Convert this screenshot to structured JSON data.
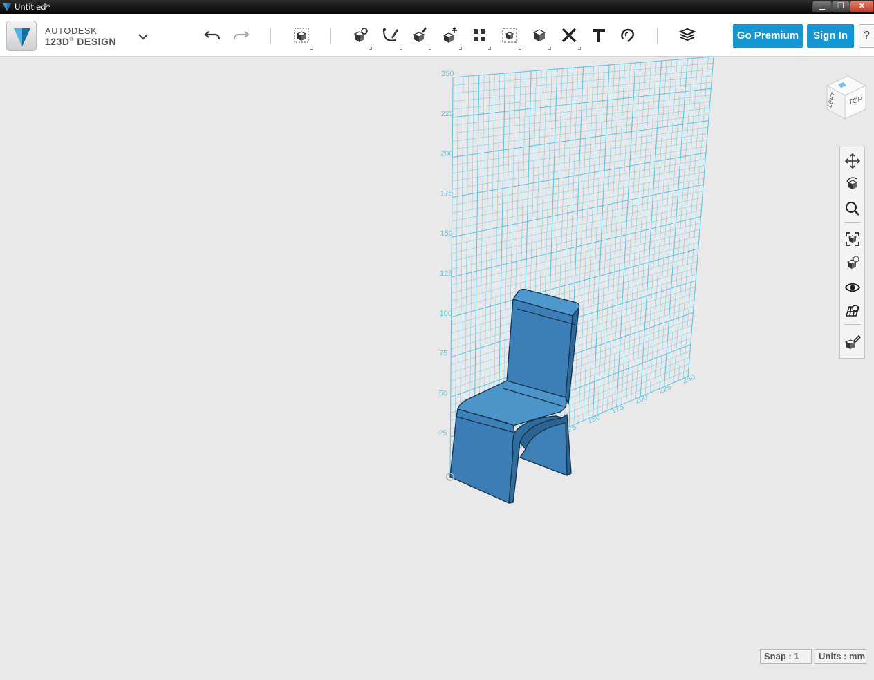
{
  "window": {
    "title": "Untitled*",
    "controls": {
      "minimize": "▁",
      "maximize": "❐",
      "close": "✕"
    }
  },
  "brand": {
    "line1": "AUTODESK",
    "line2": "123D",
    "line2_suffix": "DESIGN"
  },
  "toolbar": {
    "items": [
      {
        "icon": "undo-icon"
      },
      {
        "icon": "redo-icon"
      },
      {
        "icon": "transform-icon"
      },
      {
        "icon": "primitives-icon"
      },
      {
        "icon": "sketch-icon"
      },
      {
        "icon": "construct-icon"
      },
      {
        "icon": "modify-icon"
      },
      {
        "icon": "pattern-icon"
      },
      {
        "icon": "grouping-icon"
      },
      {
        "icon": "combine-icon"
      },
      {
        "icon": "measure-icon"
      },
      {
        "icon": "text-icon"
      },
      {
        "icon": "snap-icon"
      },
      {
        "icon": "material-icon"
      }
    ],
    "go_premium": "Go Premium",
    "sign_in": "Sign In",
    "help": "?"
  },
  "viewcube": {
    "left": "LEFT",
    "top": "TOP"
  },
  "grid": {
    "vertical_labels": [
      "250",
      "225",
      "200",
      "175",
      "150",
      "125",
      "100",
      "75",
      "50",
      "25"
    ],
    "horizontal_labels": [
      "125",
      "150",
      "175",
      "200",
      "225",
      "250"
    ],
    "color": "#5ec8e6"
  },
  "model": {
    "color": "#3a86c0"
  },
  "navbar": {
    "items": [
      "pan-icon",
      "orbit-icon",
      "zoom-icon",
      "fit-icon",
      "view-style-icon",
      "visibility-icon",
      "grid-icon",
      "material-icon"
    ]
  },
  "status": {
    "snap": "Snap : 1",
    "units": "Units : mm"
  }
}
